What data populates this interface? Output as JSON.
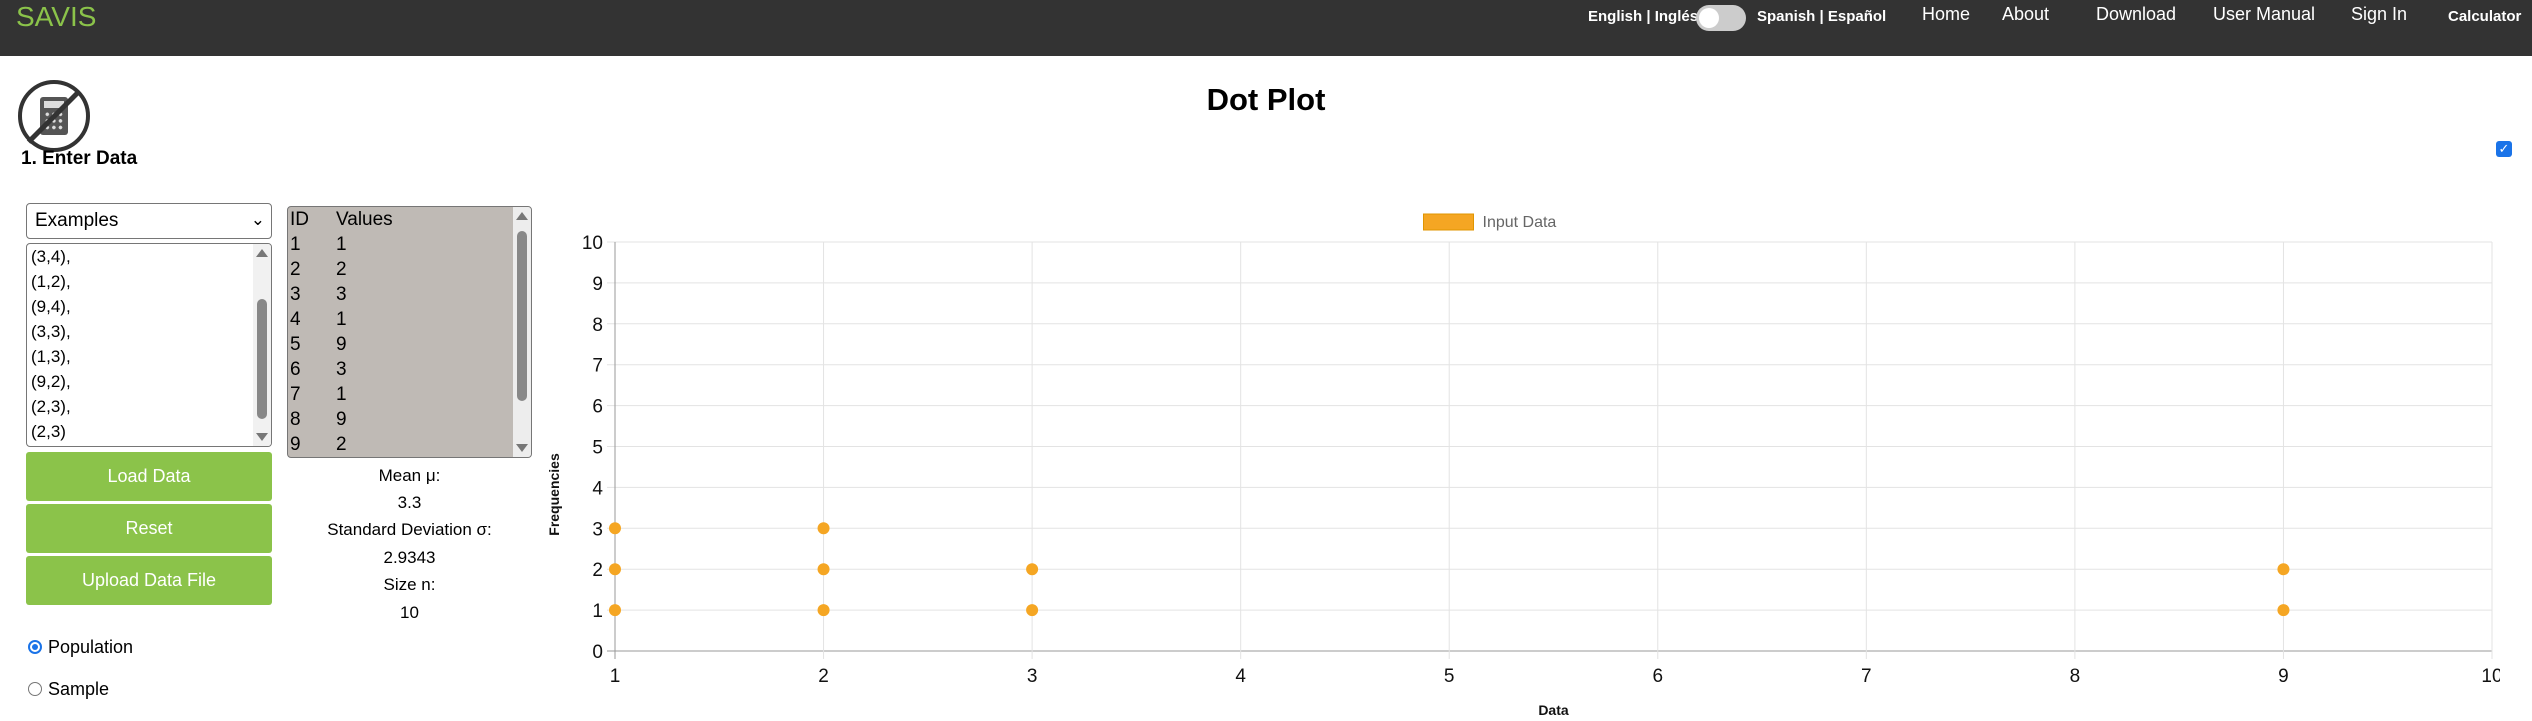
{
  "navbar": {
    "brand": "SAVIS",
    "english_label": "English | Inglés",
    "spanish_label": "Spanish | Español",
    "links": [
      "Home",
      "About",
      "Download",
      "User Manual",
      "Sign In"
    ],
    "calculator": "Calculator"
  },
  "page": {
    "title": "Dot Plot",
    "enter_data_heading": "1. Enter Data"
  },
  "input": {
    "examples_selected": "Examples",
    "example_lines": [
      "(3,4),",
      "(1,2),",
      "(9,4),",
      "(3,3),",
      "(1,3),",
      "(9,2),",
      "(2,3),",
      "(2,3)"
    ],
    "buttons": {
      "load": "Load Data",
      "reset": "Reset",
      "upload": "Upload Data File"
    },
    "radios": {
      "population": "Population",
      "sample": "Sample",
      "selected": "population"
    }
  },
  "table": {
    "headers": [
      "ID",
      "Values"
    ],
    "rows": [
      [
        "1",
        "1"
      ],
      [
        "2",
        "2"
      ],
      [
        "3",
        "3"
      ],
      [
        "4",
        "1"
      ],
      [
        "5",
        "9"
      ],
      [
        "6",
        "3"
      ],
      [
        "7",
        "1"
      ],
      [
        "8",
        "9"
      ],
      [
        "9",
        "2"
      ]
    ]
  },
  "stats": {
    "mean_label": "Mean μ:",
    "mean_value": "3.3",
    "sd_label": "Standard Deviation σ:",
    "sd_value": "2.9343",
    "size_label": "Size n:",
    "size_value": "10"
  },
  "colors": {
    "navbar": "#333333",
    "brand": "#8bc34a",
    "button": "#8bc34a",
    "point": "#f5a623",
    "table_bg": "#bfbab5"
  },
  "chart_data": {
    "type": "scatter",
    "title": "",
    "xlabel": "Data",
    "ylabel": "Frequencies",
    "xlim": [
      1,
      10
    ],
    "ylim": [
      0,
      10
    ],
    "x_ticks": [
      1,
      2,
      3,
      4,
      5,
      6,
      7,
      8,
      9,
      10
    ],
    "y_ticks": [
      0,
      1,
      2,
      3,
      4,
      5,
      6,
      7,
      8,
      9,
      10
    ],
    "grid": true,
    "legend_position": "top-center",
    "series": [
      {
        "name": "Input Data",
        "points": [
          [
            1,
            1
          ],
          [
            1,
            2
          ],
          [
            1,
            3
          ],
          [
            2,
            1
          ],
          [
            2,
            2
          ],
          [
            2,
            3
          ],
          [
            3,
            1
          ],
          [
            3,
            2
          ],
          [
            9,
            1
          ],
          [
            9,
            2
          ]
        ]
      }
    ]
  }
}
